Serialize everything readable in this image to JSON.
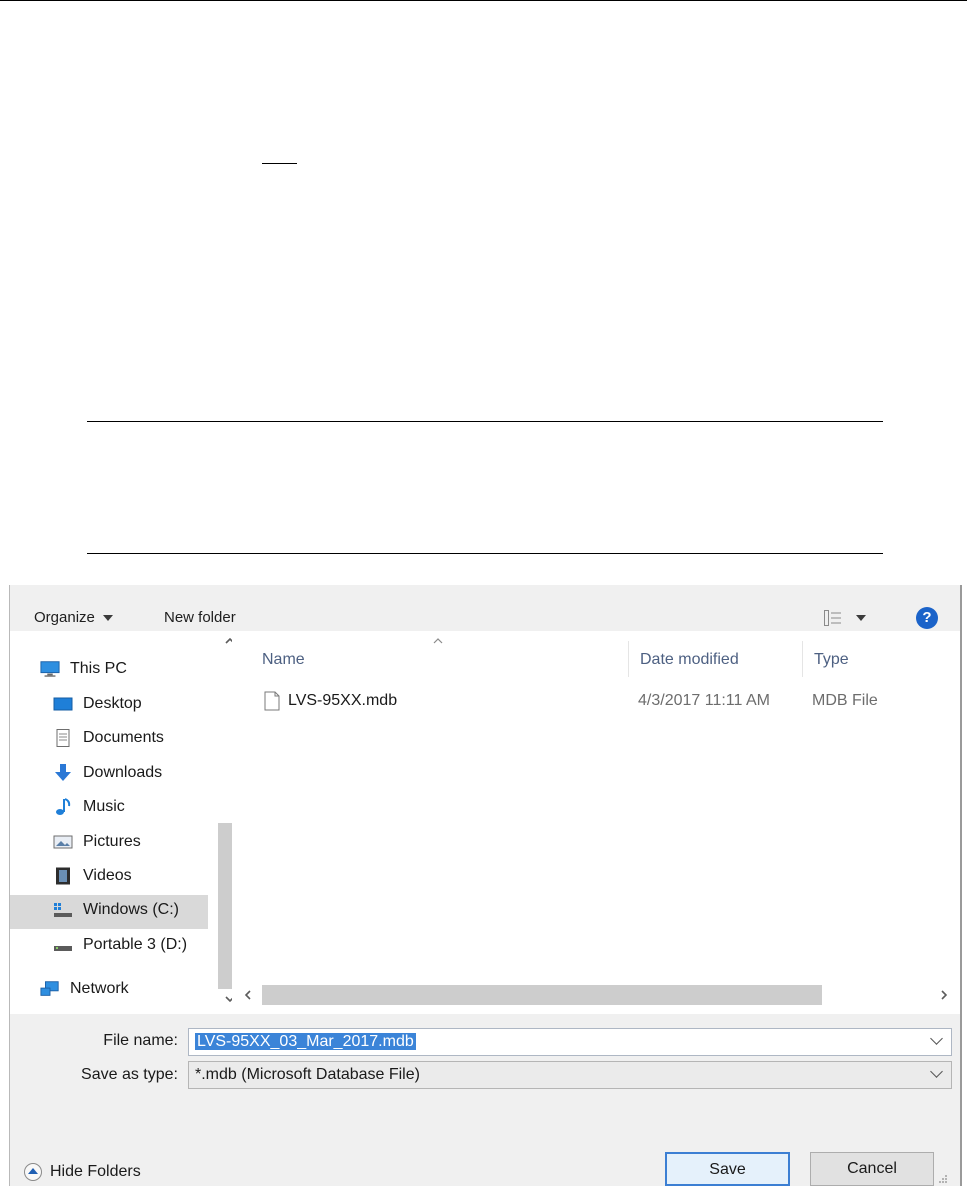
{
  "toolbar": {
    "organize": "Organize",
    "new_folder": "New folder",
    "help": "?"
  },
  "nav": {
    "items": [
      {
        "label": "This PC",
        "icon": "computer-icon"
      },
      {
        "label": "Desktop",
        "icon": "desktop-icon"
      },
      {
        "label": "Documents",
        "icon": "documents-icon"
      },
      {
        "label": "Downloads",
        "icon": "downloads-icon"
      },
      {
        "label": "Music",
        "icon": "music-icon"
      },
      {
        "label": "Pictures",
        "icon": "pictures-icon"
      },
      {
        "label": "Videos",
        "icon": "videos-icon"
      },
      {
        "label": "Windows (C:)",
        "icon": "drive-c-icon"
      },
      {
        "label": "Portable 3 (D:)",
        "icon": "drive-d-icon"
      },
      {
        "label": "Network",
        "icon": "network-icon"
      }
    ],
    "selected": "Windows (C:)"
  },
  "files": {
    "columns": [
      "Name",
      "Date modified",
      "Type"
    ],
    "rows": [
      {
        "name": "LVS-95XX.mdb",
        "date": "4/3/2017 11:11 AM",
        "type": "MDB File"
      }
    ]
  },
  "form": {
    "filename_label": "File name:",
    "filename_value": "LVS-95XX_03_Mar_2017.mdb",
    "savetype_label": "Save as type:",
    "savetype_value": "*.mdb (Microsoft Database File)",
    "hide_folders": "Hide Folders",
    "save": "Save",
    "cancel": "Cancel"
  },
  "colors": {
    "accent": "#3b84d8",
    "toolbar_bg": "#f0f0f0",
    "selection_bg": "#d9d9d9"
  }
}
